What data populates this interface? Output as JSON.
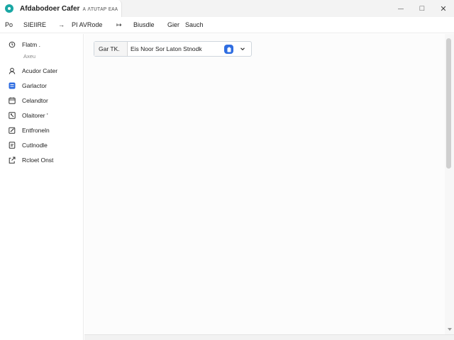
{
  "window": {
    "title": "Afdabodoer Cafer",
    "subtitle": "ᴀ ʌᴛᴜᴛᴀᴘ ᴇᴀᴀ",
    "controls": {
      "minimize": "—",
      "maximize": "□",
      "close": "✕"
    }
  },
  "menubar": {
    "items": [
      "Po",
      "SIEIIRE",
      "→",
      "PI AVRode",
      "↦",
      "Biusdle",
      "Gier",
      "Sauch"
    ]
  },
  "sidebar": {
    "items": [
      {
        "label": "Flatm .",
        "icon": "clock-icon",
        "sub": "Axeu"
      },
      {
        "label": "Acudor Cater",
        "icon": "user-icon"
      },
      {
        "label": "Garlactor",
        "icon": "card-icon",
        "active": true
      },
      {
        "label": "Celandtor",
        "icon": "calendar-icon"
      },
      {
        "label": "Olaitorer '",
        "icon": "phone-icon"
      },
      {
        "label": "Entfroneln",
        "icon": "edit-icon"
      },
      {
        "label": "Cutlnodle",
        "icon": "document-icon"
      },
      {
        "label": "Rcloet Onst",
        "icon": "export-icon"
      }
    ]
  },
  "search": {
    "prefix": "Gar TK.",
    "value": "Eis Noor Sor Laton Stnodk",
    "badge_icon": "clipboard-icon",
    "dropdown_icon": "chevron-down-icon"
  },
  "colors": {
    "accent": "#2f6de1",
    "brand": "#1aa7a4",
    "sidebar_border": "#ececec",
    "scrollbar_thumb": "#cfcfcf"
  }
}
